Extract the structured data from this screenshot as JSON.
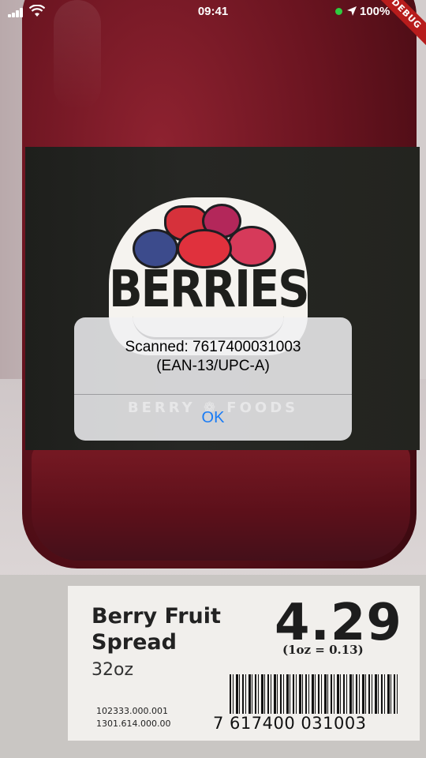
{
  "status_bar": {
    "time": "09:41",
    "battery": "100%",
    "icons": [
      "signal-icon",
      "wifi-icon",
      "location-icon"
    ],
    "dot_color": "#2ecc40"
  },
  "debug_banner": {
    "label": "DEBUG",
    "color": "#b71c1c"
  },
  "camera_view": {
    "logo_text": "BERRIES",
    "brand_text": "BERRY ❁ FOODS",
    "price_tag": {
      "product_name": "Berry Fruit Spread",
      "size": "32oz",
      "price": "4.29",
      "unit_price": "(1oz = 0.13)",
      "code_1": "102333.000.001",
      "code_2": "1301.614.000.00",
      "barcode_digits": "7 617400 031003"
    }
  },
  "alert": {
    "message": "Scanned: 7617400031003\n(EAN-13/UPC-A)",
    "button_label": "OK",
    "button_color": "#1a7cf5"
  }
}
